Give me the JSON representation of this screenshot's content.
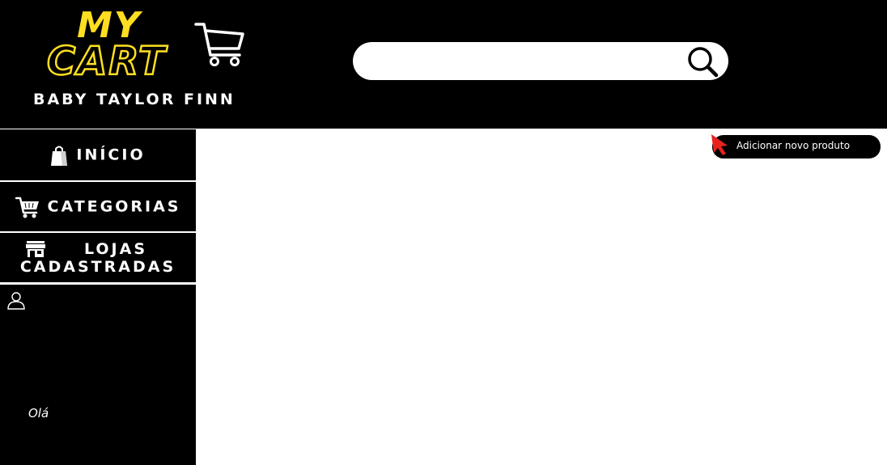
{
  "header": {
    "logo_line1": "MY",
    "logo_line2": "CART",
    "brand_name": "BABY TAYLOR FINN",
    "accent_color": "#ffde21",
    "cart_icon": "shopping-cart-icon"
  },
  "search": {
    "value": "",
    "placeholder": "",
    "icon": "search-icon"
  },
  "sidebar": {
    "items": [
      {
        "label": "INÍCIO",
        "icon": "shopping-bag-icon"
      },
      {
        "label": "CATEGORIAS",
        "icon": "shopping-cart-icon"
      },
      {
        "label": "LOJAS CADASTRADAS",
        "icon": "store-icon"
      }
    ],
    "user_icon": "user-icon",
    "greeting": "Olá"
  },
  "main": {
    "add_product_label": "Adicionar novo produto",
    "add_product_icon": "pointer-cursor-icon",
    "cursor_color": "#e8231d"
  }
}
